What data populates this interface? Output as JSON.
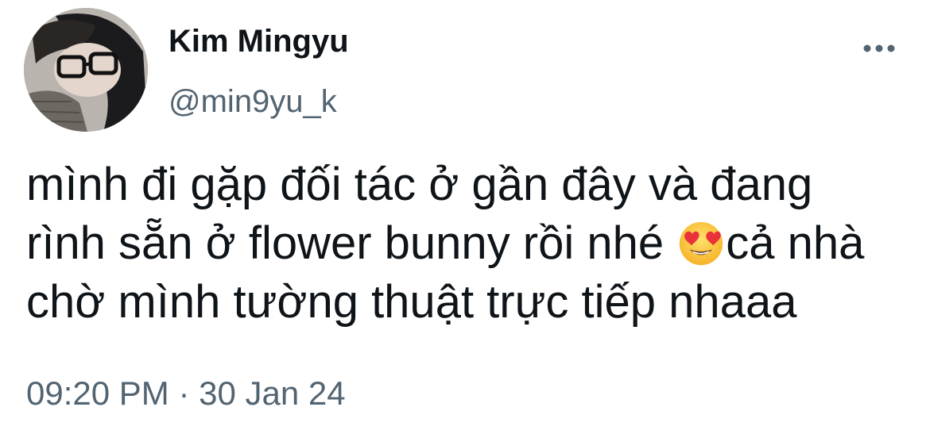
{
  "author": {
    "display_name": "Kim Mingyu",
    "handle": "@min9yu_k"
  },
  "more_icon": "more-horizontal-icon",
  "tweet": {
    "text_before_emoji": "mình đi gặp đối tác ở gần đây và đang\nrình sẵn ở flower bunny rồi nhé ",
    "emoji": "smiling-face-with-heart-eyes",
    "text_after_emoji": "cả nhà\nchờ mình tường thuật trực tiếp nhaaa"
  },
  "meta": {
    "time": "09:20 PM",
    "separator": "·",
    "date": "30 Jan 24"
  },
  "colors": {
    "text_primary": "#0f1419",
    "text_secondary": "#536471",
    "background": "#ffffff"
  }
}
